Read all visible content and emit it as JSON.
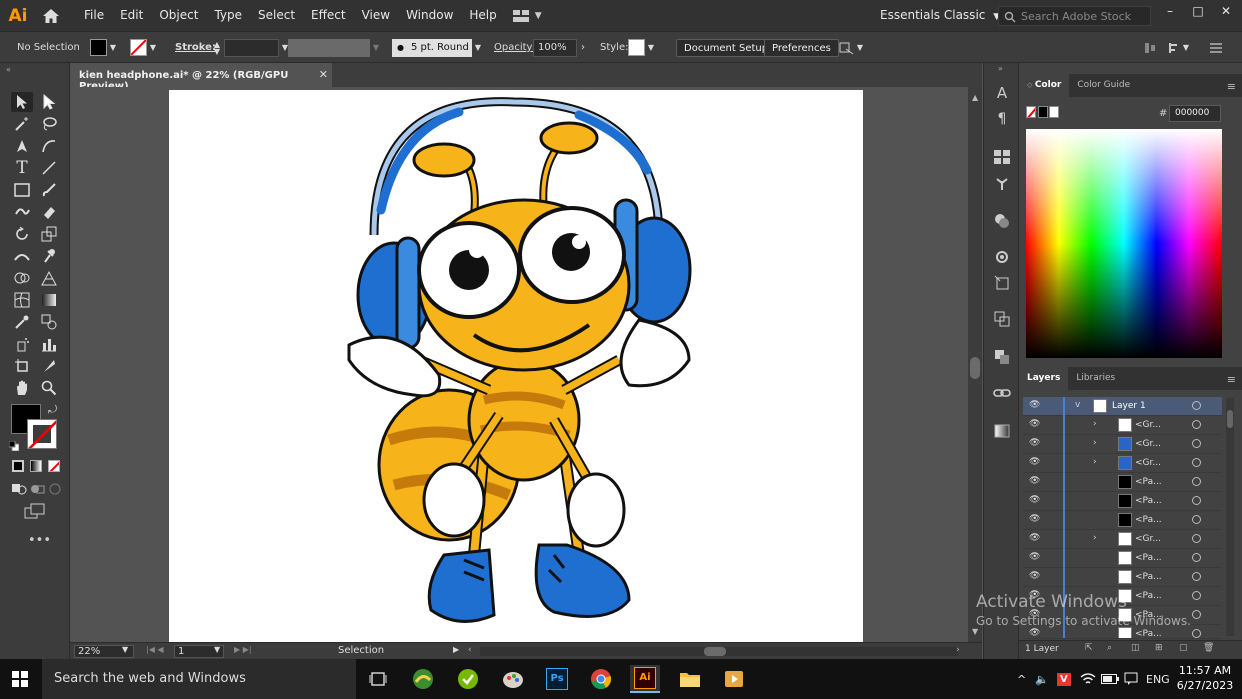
{
  "app": {
    "logo": "Ai"
  },
  "menu": {
    "items": [
      "File",
      "Edit",
      "Object",
      "Type",
      "Select",
      "Effect",
      "View",
      "Window",
      "Help"
    ]
  },
  "workspace": {
    "label": "Essentials Classic"
  },
  "search": {
    "placeholder": "Search Adobe Stock"
  },
  "window_controls": {
    "minimize": "–",
    "maximize": "□",
    "close": "✕"
  },
  "control_bar": {
    "selection": "No Selection",
    "stroke_label": "Stroke:",
    "brush": "5 pt. Round",
    "opacity_label": "Opacity:",
    "opacity_value": "100%",
    "style_label": "Style:",
    "document_setup": "Document Setup",
    "preferences": "Preferences"
  },
  "document_tab": {
    "title": "kien headphone.ai* @ 22% (RGB/GPU Preview)",
    "close": "✕"
  },
  "status_bar": {
    "zoom": "22%",
    "artboard": "1",
    "tool": "Selection"
  },
  "color_panel": {
    "tabs": [
      "Color",
      "Color Guide"
    ],
    "hex_label": "#",
    "hex_value": "000000",
    "colors": {
      "fill": "#000000",
      "stroke": "none"
    }
  },
  "layers_panel": {
    "tabs": [
      "Layers",
      "Libraries"
    ],
    "top_layer": "Layer 1",
    "rows": [
      "<Gr...",
      "<Gr...",
      "<Gr...",
      "<Pa...",
      "<Pa...",
      "<Pa...",
      "<Gr...",
      "<Pa...",
      "<Pa...",
      "<Pa...",
      "<Pa...",
      "<Pa..."
    ],
    "footer": "1 Layer"
  },
  "watermark": {
    "line1": "Activate Windows",
    "line2": "Go to Settings to activate Windows."
  },
  "taskbar": {
    "search": "Search the web and Windows",
    "apps": [
      "task-view",
      "maps",
      "torrent",
      "paint",
      "photoshop",
      "chrome",
      "illustrator",
      "file-explorer",
      "media-player"
    ],
    "lang": "ENG",
    "time": "11:57 AM",
    "date": "6/27/2023"
  },
  "artwork": {
    "accent_yellow": "#f7b41a",
    "accent_blue": "#1f6fd1"
  }
}
